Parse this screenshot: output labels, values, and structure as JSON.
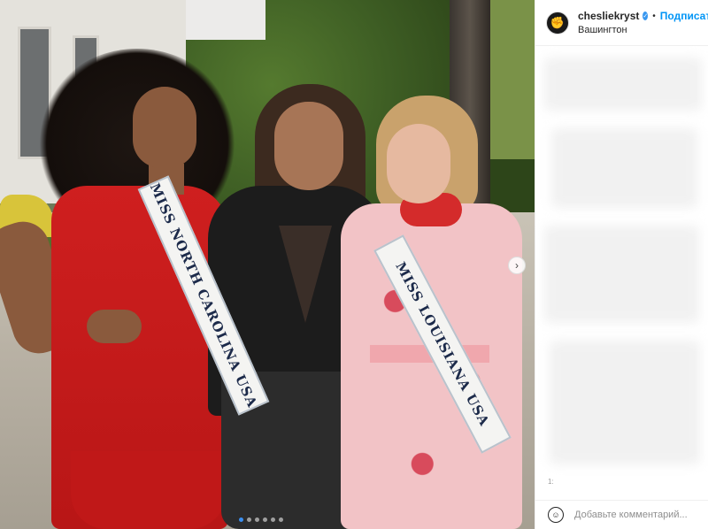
{
  "post": {
    "username": "chesliekryst",
    "separator": "•",
    "follow_label": "Подписат",
    "location": "Вашингтон",
    "comment_placeholder": "Добавьте комментарий...",
    "carousel_index": 1,
    "carousel_total": 6
  },
  "photo": {
    "sash_left_text": "MISS NORTH CAROLINA USA",
    "sash_right_text": "MISS LOUISIANA USA"
  },
  "icons": {
    "avatar": "fist-avatar-icon",
    "verified": "verified-badge-icon",
    "next": "chevron-right-icon",
    "emoji": "smiley-icon"
  },
  "colors": {
    "accent": "#0095f6",
    "verified": "#3897f0",
    "dot_active": "#3b8ff0"
  },
  "misc": {
    "stray_number": "1:"
  }
}
